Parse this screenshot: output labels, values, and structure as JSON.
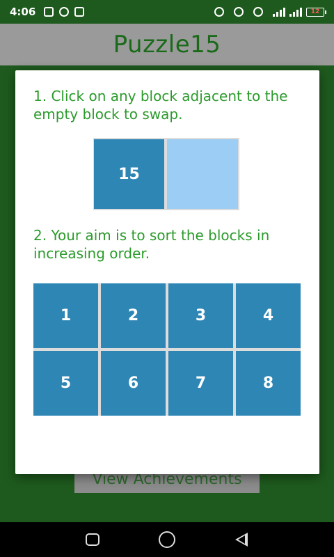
{
  "status_bar": {
    "time": "4:06",
    "battery_level": "12"
  },
  "app": {
    "title": "Puzzle15",
    "background_button_label": "View Achievements"
  },
  "dialog": {
    "step1_text": "1. Click on any block adjacent to the empty block to swap.",
    "step2_text": "2. Your aim is to sort the blocks in increasing order.",
    "demo_tile": "15",
    "grid_tiles": [
      "1",
      "2",
      "3",
      "4",
      "5",
      "6",
      "7",
      "8"
    ]
  },
  "colors": {
    "tile": "#2e86b5",
    "empty_tile": "#9bcdf5",
    "instruction_text": "#2b9a2b",
    "title_text": "#1a6a1a"
  },
  "nav_icons": [
    "recent-apps-icon",
    "home-icon",
    "back-icon"
  ]
}
